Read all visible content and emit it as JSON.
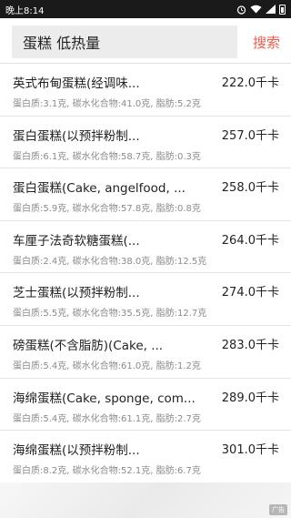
{
  "status_bar": {
    "time": "晚上8:14",
    "icons": [
      "alarm-icon",
      "wifi-icon",
      "signal-icon",
      "battery-icon"
    ]
  },
  "search": {
    "query": "蛋糕 低热量",
    "button_label": "搜索"
  },
  "accent_color": "#f05a4a",
  "foods": [
    {
      "name": "英式布甸蛋糕(经调味...",
      "calories": "222.0千卡",
      "nutrition": "蛋白质:3.1克, 碳水化合物:41.0克, 脂肪:5.2克"
    },
    {
      "name": "蛋白蛋糕(以预拌粉制...",
      "calories": "257.0千卡",
      "nutrition": "蛋白质:6.1克, 碳水化合物:58.7克, 脂肪:0.3克"
    },
    {
      "name": "蛋白蛋糕(Cake, angelfood, ...",
      "calories": "258.0千卡",
      "nutrition": "蛋白质:5.9克, 碳水化合物:57.8克, 脂肪:0.8克"
    },
    {
      "name": "车厘子法奇软糖蛋糕(...",
      "calories": "264.0千卡",
      "nutrition": "蛋白质:2.4克, 碳水化合物:38.0克, 脂肪:12.5克"
    },
    {
      "name": "芝士蛋糕(以预拌粉制...",
      "calories": "274.0千卡",
      "nutrition": "蛋白质:5.5克, 碳水化合物:35.5克, 脂肪:12.7克"
    },
    {
      "name": "磅蛋糕(不含脂肪)(Cake, ...",
      "calories": "283.0千卡",
      "nutrition": "蛋白质:5.4克, 碳水化合物:61.0克, 脂肪:1.2克"
    },
    {
      "name": "海绵蛋糕(Cake, sponge, com...",
      "calories": "289.0千卡",
      "nutrition": "蛋白质:5.4克, 碳水化合物:61.1克, 脂肪:2.7克"
    },
    {
      "name": "海绵蛋糕(以预拌粉制...",
      "calories": "301.0千卡",
      "nutrition": "蛋白质:8.2克, 碳水化合物:52.1克, 脂肪:6.7克"
    }
  ],
  "ad_label": "广告"
}
